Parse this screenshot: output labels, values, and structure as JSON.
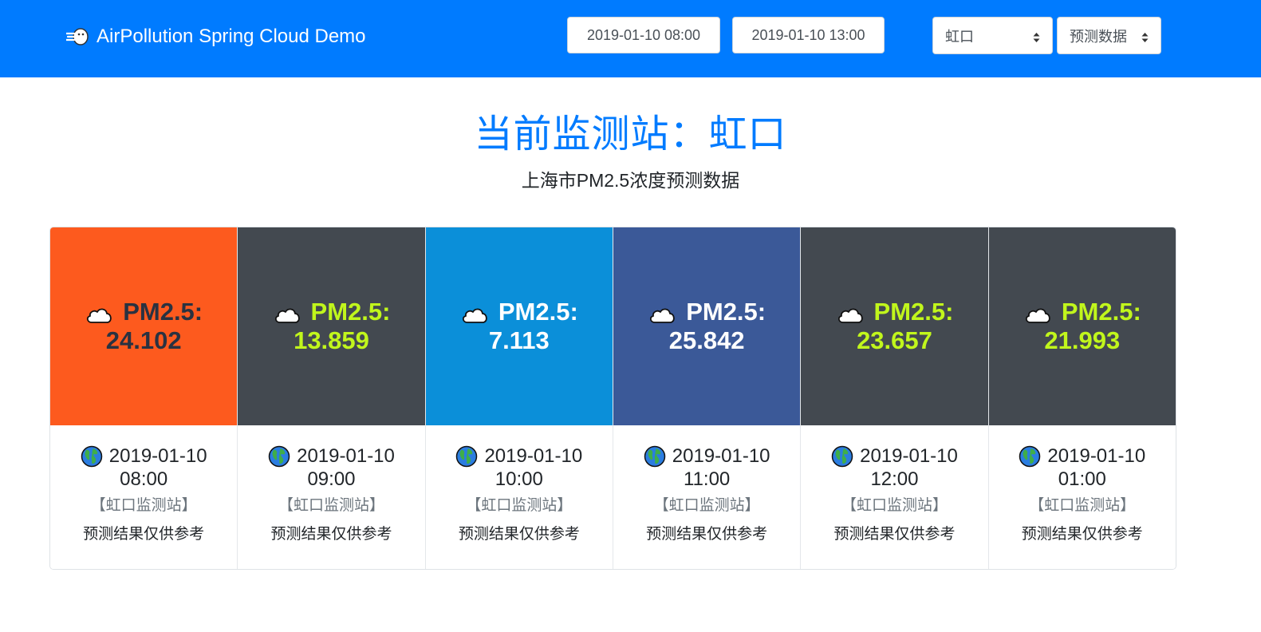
{
  "navbar": {
    "brand_text": "AirPollution Spring Cloud Demo",
    "brand_icon": "wind-face-icon",
    "start_time": "2019-01-10 08:00",
    "end_time": "2019-01-10 13:00",
    "station_select": "虹口",
    "mode_select": "预测数据",
    "bg_color": "#007bff"
  },
  "header": {
    "title": "当前监测站：虹口",
    "subtitle": "上海市PM2.5浓度预测数据"
  },
  "cards": [
    {
      "pm_label": "PM2.5:",
      "pm_value": "24.102",
      "date": "2019-01-10",
      "hour": "08:00",
      "station": "【虹口监测站】",
      "note": "预测结果仅供参考",
      "bg": "#fd5a1e",
      "text_color": "#293241"
    },
    {
      "pm_label": "PM2.5:",
      "pm_value": "13.859",
      "date": "2019-01-10",
      "hour": "09:00",
      "station": "【虹口监测站】",
      "note": "预测结果仅供参考",
      "bg": "#434950",
      "text_color": "#c1f61c"
    },
    {
      "pm_label": "PM2.5:",
      "pm_value": "7.113",
      "date": "2019-01-10",
      "hour": "10:00",
      "station": "【虹口监测站】",
      "note": "预测结果仅供参考",
      "bg": "#0b8fd9",
      "text_color": "#ffffff"
    },
    {
      "pm_label": "PM2.5:",
      "pm_value": "25.842",
      "date": "2019-01-10",
      "hour": "11:00",
      "station": "【虹口监测站】",
      "note": "预测结果仅供参考",
      "bg": "#3b5998",
      "text_color": "#ffffff"
    },
    {
      "pm_label": "PM2.5:",
      "pm_value": "23.657",
      "date": "2019-01-10",
      "hour": "12:00",
      "station": "【虹口监测站】",
      "note": "预测结果仅供参考",
      "bg": "#434950",
      "text_color": "#c1f61c"
    },
    {
      "pm_label": "PM2.5:",
      "pm_value": "21.993",
      "date": "2019-01-10",
      "hour": "01:00",
      "station": "【虹口监测站】",
      "note": "预测结果仅供参考",
      "bg": "#434950",
      "text_color": "#c1f61c"
    }
  ]
}
